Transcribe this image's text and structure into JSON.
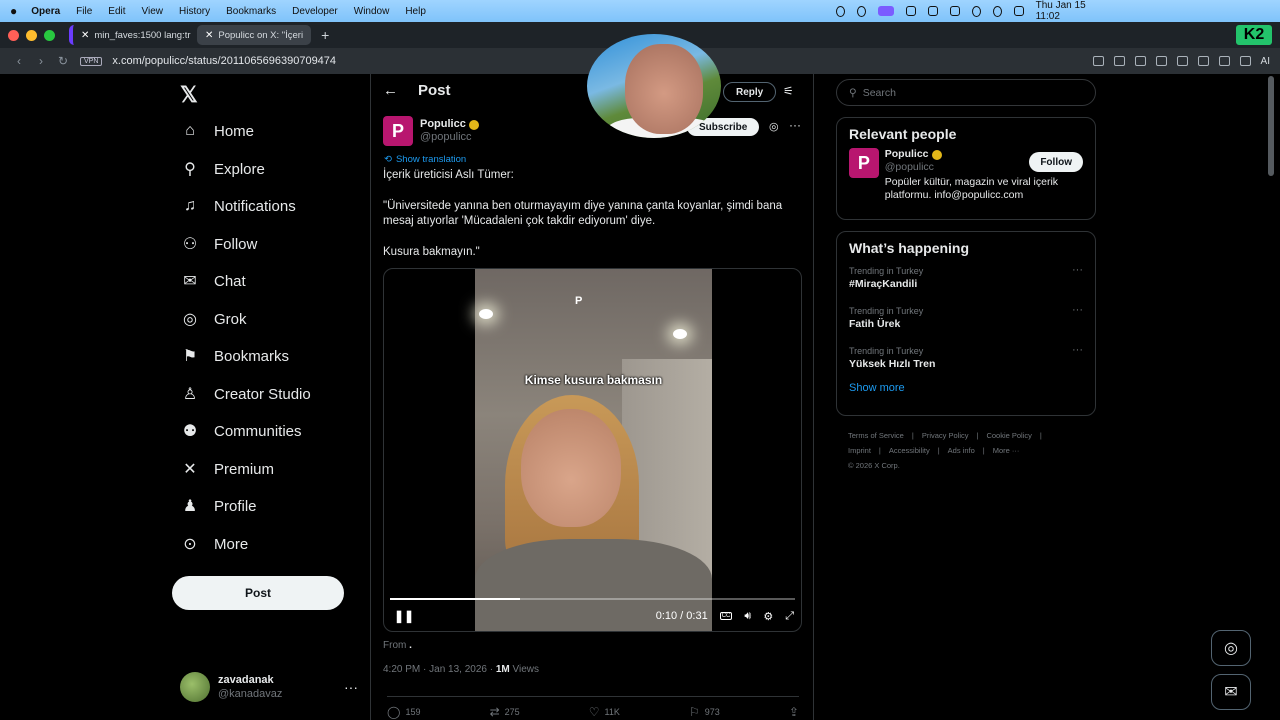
{
  "menubar": {
    "app": "Opera",
    "items": [
      "File",
      "Edit",
      "View",
      "History",
      "Bookmarks",
      "Developer",
      "Window",
      "Help"
    ],
    "clock": "Thu Jan 15  11:02"
  },
  "tabs": [
    {
      "title": "min_faves:1500 lang:tr",
      "icon": "x-logo-icon"
    },
    {
      "title": "Populicc on X: \"İçeri",
      "icon": "x-logo-icon"
    }
  ],
  "opera_badge": "K2",
  "address": {
    "vpn": "VPN",
    "url": "x.com/populicc/status/2011065696390709474",
    "ai_label": "AI"
  },
  "nav": {
    "items": [
      {
        "label": "Home",
        "icon": "home-icon",
        "glyph": "⌂"
      },
      {
        "label": "Explore",
        "icon": "search-icon",
        "glyph": "⚲"
      },
      {
        "label": "Notifications",
        "icon": "bell-icon",
        "glyph": "♫"
      },
      {
        "label": "Follow",
        "icon": "person-add-icon",
        "glyph": "⚇"
      },
      {
        "label": "Chat",
        "icon": "mail-icon",
        "glyph": "✉"
      },
      {
        "label": "Grok",
        "icon": "grok-icon",
        "glyph": "◎"
      },
      {
        "label": "Bookmarks",
        "icon": "bookmark-icon",
        "glyph": "⚑"
      },
      {
        "label": "Creator Studio",
        "icon": "creator-icon",
        "glyph": "♙"
      },
      {
        "label": "Communities",
        "icon": "communities-icon",
        "glyph": "⚉"
      },
      {
        "label": "Premium",
        "icon": "x-logo-icon",
        "glyph": "✕"
      },
      {
        "label": "Profile",
        "icon": "profile-icon",
        "glyph": "♟"
      },
      {
        "label": "More",
        "icon": "more-circle-icon",
        "glyph": "⊙"
      }
    ],
    "post_button": "Post",
    "account": {
      "name": "zavadanak",
      "handle": "@kanadavaz"
    }
  },
  "post": {
    "header_title": "Post",
    "reply_label": "Reply",
    "subscribe_label": "Subscribe",
    "author": {
      "name": "Populicc",
      "handle": "@populicc",
      "avatar_letter": "P"
    },
    "show_translation": "Show translation",
    "text": [
      "İçerik üreticisi Aslı Tümer:",
      "\"Üniversitede yanına ben oturmayayım diye yanına çanta koyanlar, şimdi bana mesaj atıyorlar 'Mücadaleni çok takdir ediyorum' diye.",
      "Kusura bakmayın.\""
    ],
    "video": {
      "caption": "Kimse kusura bakmasın",
      "watermark": "P",
      "time": "0:10 / 0:31",
      "progress": 0.32
    },
    "from": "From",
    "timestamp": "4:20 PM · Jan 13, 2026 · ",
    "views": "1M",
    "views_label": " Views",
    "actions": {
      "replies": "159",
      "reposts": "275",
      "likes": "11K",
      "bookmarks": "973"
    }
  },
  "sidebar": {
    "search_placeholder": "Search",
    "relevant_title": "Relevant people",
    "relevant_person": {
      "name": "Populicc",
      "handle": "@populicc",
      "bio": "Popüler kültür, magazin ve viral içerik platformu. info@populicc.com",
      "follow_label": "Follow",
      "avatar_letter": "P"
    },
    "happening_title": "What’s happening",
    "trends": [
      {
        "category": "Trending in Turkey",
        "name": "#MiraçKandili"
      },
      {
        "category": "Trending in Turkey",
        "name": "Fatih Ürek"
      },
      {
        "category": "Trending in Turkey",
        "name": "Yüksek Hızlı Tren"
      }
    ],
    "show_more": "Show more",
    "footer": [
      "Terms of Service",
      "|",
      "Privacy Policy",
      "|",
      "Cookie Policy",
      "|",
      "Imprint",
      "|",
      "Accessibility",
      "|",
      "Ads info",
      "|",
      "More ···"
    ],
    "copyright": "© 2026 X Corp."
  },
  "colors": {
    "accent": "#1d9bf0",
    "brand_pink": "#b8166f",
    "verified": "#e2b719"
  }
}
